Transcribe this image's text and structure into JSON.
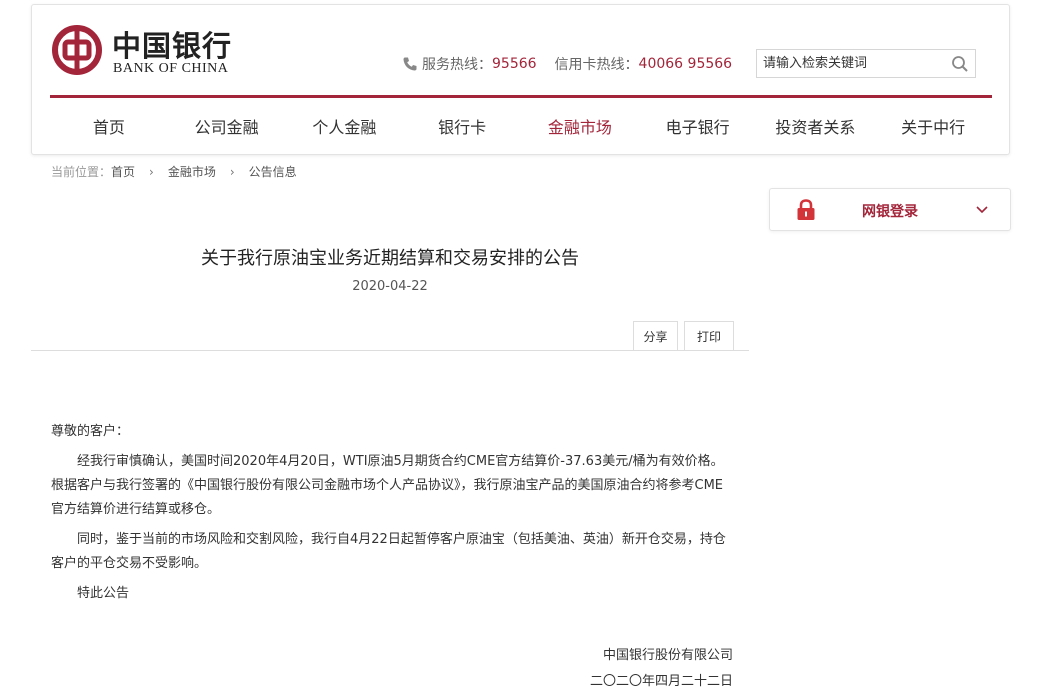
{
  "header": {
    "logo_cn": "中国银行",
    "logo_en": "BANK OF CHINA",
    "service_hotline_label": "服务热线：",
    "service_hotline_number": "95566",
    "credit_hotline_label": "信用卡热线：",
    "credit_hotline_number": "40066 95566",
    "search_placeholder": "请输入检索关键词",
    "brand_color": "#a3253a"
  },
  "nav": {
    "items": [
      {
        "label": "首页"
      },
      {
        "label": "公司金融"
      },
      {
        "label": "个人金融"
      },
      {
        "label": "银行卡"
      },
      {
        "label": "金融市场"
      },
      {
        "label": "电子银行"
      },
      {
        "label": "投资者关系"
      },
      {
        "label": "关于中行"
      }
    ],
    "active_index": 4
  },
  "breadcrumb": {
    "prefix": "当前位置：",
    "items": [
      "首页",
      "金融市场",
      "公告信息"
    ]
  },
  "login": {
    "label": "网银登录"
  },
  "article": {
    "title": "关于我行原油宝业务近期结算和交易安排的公告",
    "date": "2020-04-22",
    "share_label": "分享",
    "print_label": "打印",
    "salutation": "尊敬的客户：",
    "paragraph_1": "经我行审慎确认，美国时间2020年4月20日，WTI原油5月期货合约CME官方结算价-37.63美元/桶为有效价格。根据客户与我行签署的《中国银行股份有限公司金融市场个人产品协议》，我行原油宝产品的美国原油合约将参考CME官方结算价进行结算或移仓。",
    "paragraph_2": "同时，鉴于当前的市场风险和交割风险，我行自4月22日起暂停客户原油宝（包括美油、英油）新开仓交易，持仓客户的平仓交易不受影响。",
    "closing": "特此公告",
    "signature_org": "中国银行股份有限公司",
    "signature_date": "二〇二〇年四月二十二日"
  }
}
